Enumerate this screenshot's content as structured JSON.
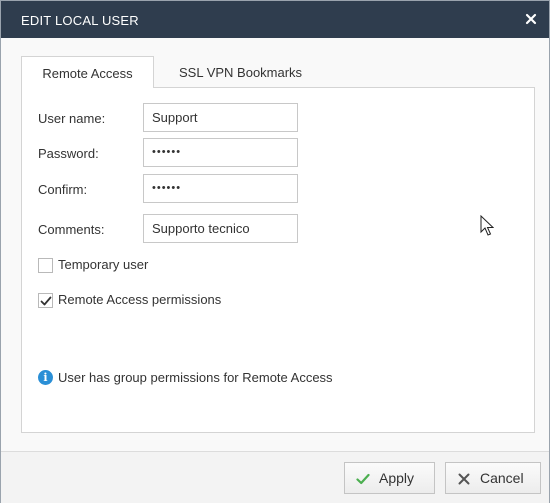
{
  "dialog": {
    "title": "EDIT LOCAL USER"
  },
  "tabs": [
    {
      "label": "Remote Access",
      "active": true
    },
    {
      "label": "SSL VPN Bookmarks",
      "active": false
    }
  ],
  "form": {
    "username_label": "User name:",
    "username_value": "Support",
    "password_label": "Password:",
    "password_value": "••••••",
    "confirm_label": "Confirm:",
    "confirm_value": "••••••",
    "comments_label": "Comments:",
    "comments_value": "Supporto tecnico",
    "temporary_label": "Temporary user",
    "temporary_checked": false,
    "remote_access_label": "Remote Access permissions",
    "remote_access_checked": true,
    "info_text": "User has group permissions for Remote Access"
  },
  "footer": {
    "apply_label": "Apply",
    "cancel_label": "Cancel"
  },
  "icons": {
    "close": "close-icon",
    "info": "info-icon",
    "check": "checkmark-icon",
    "cancel": "x-icon",
    "cursor": "mouse-cursor"
  },
  "colors": {
    "titlebar": "#2f3d4e",
    "accent_blue": "#2a8fd6",
    "apply_check": "#4caf50",
    "cancel_x": "#555555"
  }
}
